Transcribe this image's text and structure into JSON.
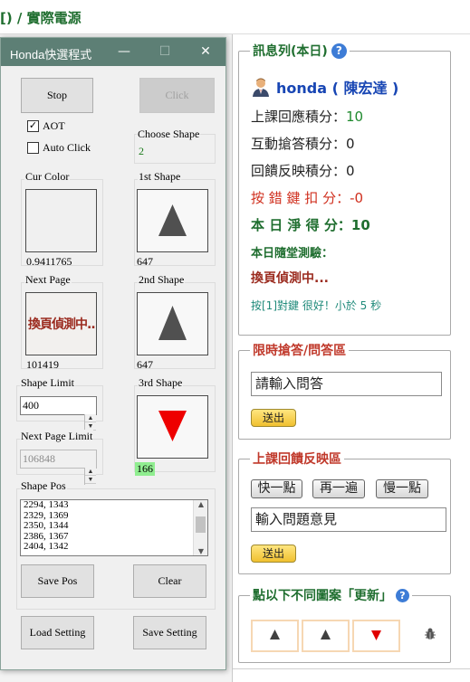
{
  "page": {
    "title_prefix": "[) / ",
    "title": "實際電源"
  },
  "info_panel": {
    "legend": "訊息列(本日)",
    "help_icon": "?",
    "user_name": "honda ( 陳宏達 )",
    "stats": [
      {
        "label": "上課回應積分：",
        "value": "10"
      },
      {
        "label": "互動搶答積分：",
        "value": "0"
      },
      {
        "label": "回饋反映積分：",
        "value": "0"
      }
    ],
    "penalty": {
      "label": "按 錯 鍵 扣 分：",
      "value": "-0"
    },
    "net": {
      "label": "本 日 淨 得 分：",
      "value": "10"
    },
    "quiz": "本日隨堂測驗：",
    "change_page": "換頁偵測中...",
    "message_prefix": "按[1]對鍵 ",
    "message_body": "很好！小於 5 秒"
  },
  "quick_answer": {
    "legend": "限時搶答/問答區",
    "input_value": "請輸入問答",
    "submit_label": "送出"
  },
  "feedback": {
    "legend": "上課回饋反映區",
    "buttons": [
      "快一點",
      "再一遍",
      "慢一點"
    ],
    "input_value": "輸入問題意見",
    "submit_label": "送出"
  },
  "shapes_panel": {
    "legend": "點以下不同圖案「更新」",
    "help_icon": "?",
    "shapes": [
      "▲",
      "▲",
      "▼"
    ]
  },
  "dialog": {
    "title": "Honda快選程式",
    "window_controls": [
      "—",
      "☐",
      "✕"
    ],
    "stop_label": "Stop",
    "click_label": "Click",
    "aot": {
      "label": "AOT",
      "checked": true
    },
    "auto_click": {
      "label": "Auto Click",
      "checked": false
    },
    "choose_shape": {
      "label": "Choose Shape",
      "value": "2"
    },
    "cur_color": {
      "label": "Cur Color",
      "value": "0.9411765"
    },
    "shape1": {
      "label": "1st Shape",
      "value": "647"
    },
    "next_page": {
      "label": "Next Page",
      "value": "101419",
      "preview_text": "換頁偵測中..."
    },
    "shape2": {
      "label": "2nd Shape",
      "value": "647"
    },
    "shape_limit": {
      "label": "Shape Limit",
      "value": "400"
    },
    "shape3": {
      "label": "3rd Shape",
      "value": "166"
    },
    "next_page_limit": {
      "label": "Next Page Limit",
      "value": "106848"
    },
    "shape_pos": {
      "label": "Shape Pos",
      "items": [
        "2294, 1343",
        "2329, 1369",
        "2350, 1344",
        "2386, 1367",
        "2404, 1342"
      ]
    },
    "save_pos_label": "Save Pos",
    "clear_label": "Clear",
    "load_setting_label": "Load Setting",
    "save_setting_label": "Save Setting"
  },
  "colors": {
    "green_text": "#1f6e2f",
    "red_text": "#d0301f",
    "blue_name": "#1846b4",
    "titlebar": "#5d7f75",
    "highlight_green": "#90ee90"
  }
}
